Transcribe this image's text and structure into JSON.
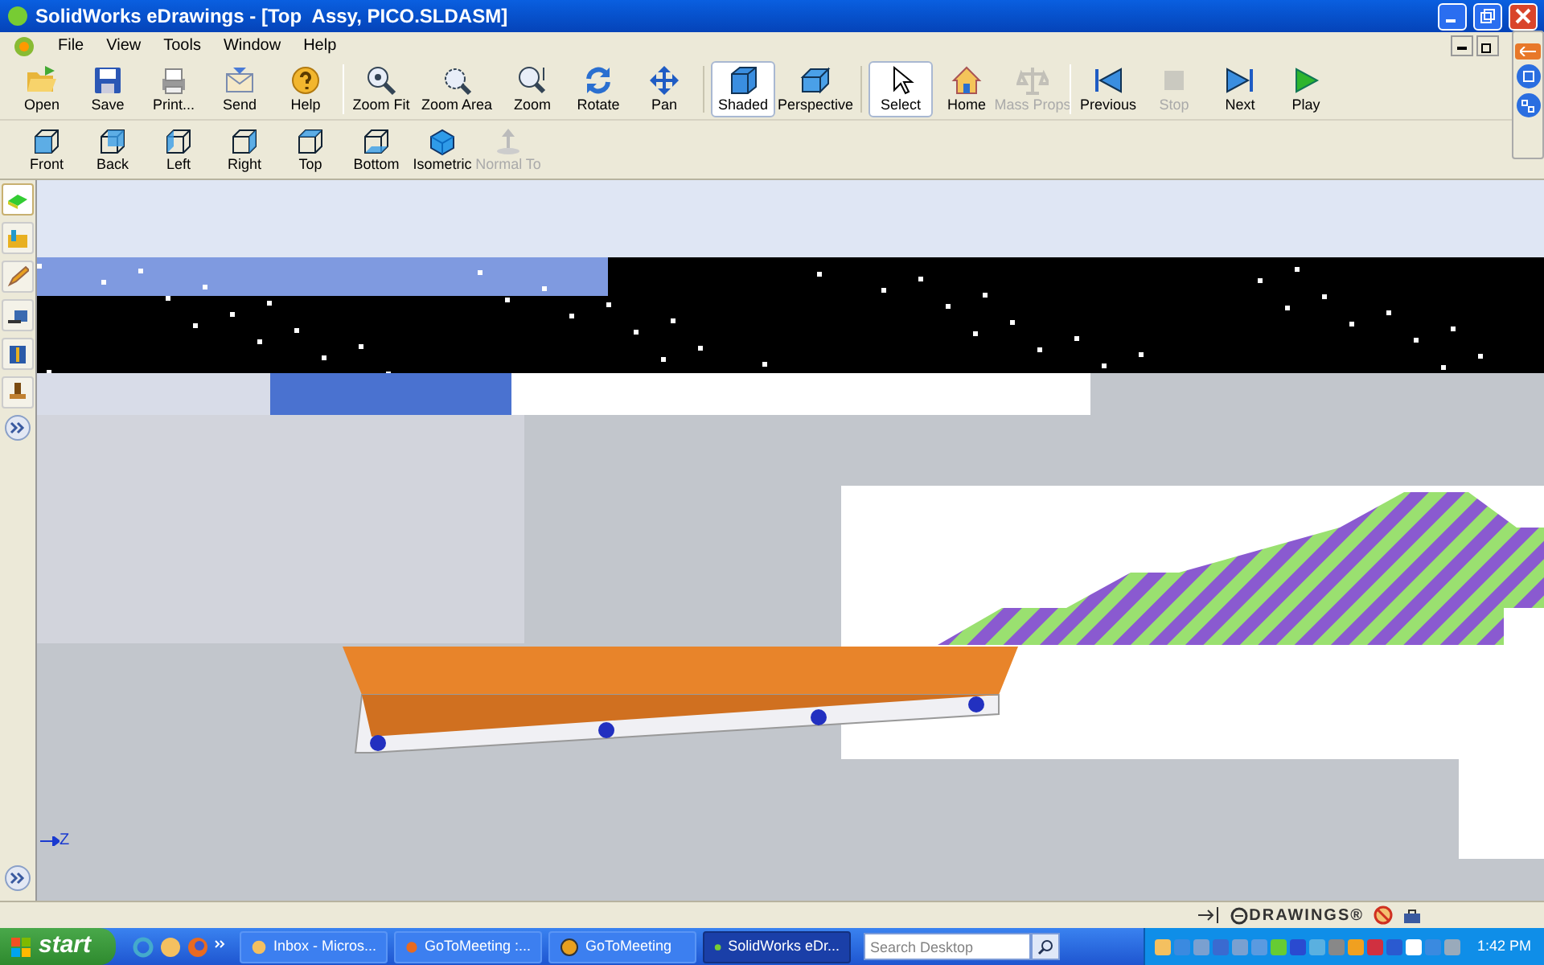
{
  "window": {
    "title": "SolidWorks eDrawings - [Top  Assy, PICO.SLDASM]"
  },
  "menu": [
    "File",
    "View",
    "Tools",
    "Window",
    "Help"
  ],
  "toolbar": [
    [
      {
        "label": "Open",
        "disabled": false,
        "selected": false
      },
      {
        "label": "Save",
        "disabled": false,
        "selected": false
      },
      {
        "label": "Print...",
        "disabled": false,
        "selected": false
      },
      {
        "label": "Send",
        "disabled": false,
        "selected": false
      },
      {
        "label": "Help",
        "disabled": false,
        "selected": false
      }
    ],
    [
      {
        "label": "Zoom Fit",
        "disabled": false,
        "selected": false
      },
      {
        "label": "Zoom Area",
        "disabled": false,
        "selected": false
      },
      {
        "label": "Zoom",
        "disabled": false,
        "selected": false
      },
      {
        "label": "Rotate",
        "disabled": false,
        "selected": false
      },
      {
        "label": "Pan",
        "disabled": false,
        "selected": false
      },
      {
        "label": "Shaded",
        "disabled": false,
        "selected": true
      },
      {
        "label": "Perspective",
        "disabled": false,
        "selected": false
      },
      {
        "label": "Select",
        "disabled": false,
        "selected": true
      },
      {
        "label": "Home",
        "disabled": false,
        "selected": false
      },
      {
        "label": "Mass Props",
        "disabled": true,
        "selected": false
      }
    ],
    [
      {
        "label": "Previous",
        "disabled": false,
        "selected": false
      },
      {
        "label": "Stop",
        "disabled": true,
        "selected": false
      },
      {
        "label": "Next",
        "disabled": false,
        "selected": false
      },
      {
        "label": "Play",
        "disabled": false,
        "selected": false
      }
    ]
  ],
  "views": [
    {
      "label": "Front",
      "disabled": false
    },
    {
      "label": "Back",
      "disabled": false
    },
    {
      "label": "Left",
      "disabled": false
    },
    {
      "label": "Right",
      "disabled": false
    },
    {
      "label": "Top",
      "disabled": false
    },
    {
      "label": "Bottom",
      "disabled": false
    },
    {
      "label": "Isometric",
      "disabled": false
    },
    {
      "label": "Normal To",
      "disabled": true
    }
  ],
  "sidebar": [
    {
      "selected": true
    },
    {
      "selected": false
    },
    {
      "selected": false
    },
    {
      "selected": false
    },
    {
      "selected": false
    },
    {
      "selected": false
    }
  ],
  "viewport": {
    "axis_label": "Z"
  },
  "status_bar": {
    "logo": "DRAWINGS®"
  },
  "taskbar": {
    "start": "start",
    "tasks": [
      {
        "label": "Inbox - Micros...",
        "selected": false
      },
      {
        "label": "GoToMeeting :...",
        "selected": false
      },
      {
        "label": "GoToMeeting",
        "selected": false
      },
      {
        "label": "SolidWorks eDr...",
        "selected": true
      }
    ],
    "search": {
      "placeholder": "Search Desktop"
    },
    "clock": "1:42 PM"
  }
}
